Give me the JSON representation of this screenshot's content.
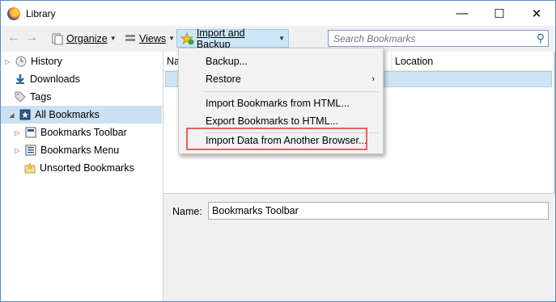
{
  "window": {
    "title": "Library",
    "minimize": "—",
    "maximize": "☐",
    "close": "✕"
  },
  "toolbar": {
    "back": "←",
    "forward": "→",
    "organize_label": "Organize",
    "views_label": "Views",
    "import_backup_label": "Import and Backup",
    "search_placeholder": "Search Bookmarks"
  },
  "sidebar": {
    "items": [
      {
        "label": "History",
        "icon": "clock-icon"
      },
      {
        "label": "Downloads",
        "icon": "download-arrow-icon"
      },
      {
        "label": "Tags",
        "icon": "tag-icon"
      },
      {
        "label": "All Bookmarks",
        "icon": "star-folder-icon",
        "selected": true
      },
      {
        "label": "Bookmarks Toolbar",
        "icon": "toolbar-icon"
      },
      {
        "label": "Bookmarks Menu",
        "icon": "menu-list-icon"
      },
      {
        "label": "Unsorted Bookmarks",
        "icon": "folder-star-icon"
      }
    ]
  },
  "main": {
    "columns": [
      "Na",
      "Location"
    ]
  },
  "details": {
    "name_label": "Name:",
    "name_value": "Bookmarks Toolbar"
  },
  "menu": {
    "items": [
      {
        "label": "Backup..."
      },
      {
        "label": "Restore",
        "submenu": true
      },
      {
        "label": "Import Bookmarks from HTML..."
      },
      {
        "label": "Export Bookmarks to HTML..."
      },
      {
        "label": "Import Data from Another Browser...",
        "highlighted": true
      }
    ]
  },
  "colors": {
    "accent": "#cde6f7",
    "highlight_border": "#e86060",
    "selection": "#cce0f4"
  }
}
